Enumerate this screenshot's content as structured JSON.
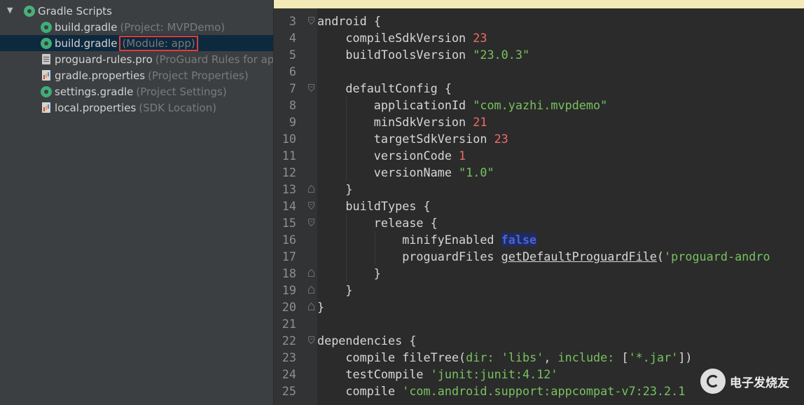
{
  "project_tree": {
    "root": {
      "label": "Gradle Scripts",
      "expanded": true
    },
    "items": [
      {
        "name": "build.gradle",
        "hint": "(Project: MVPDemo)",
        "icon": "gradle-icon",
        "selected": false,
        "highlighted": false
      },
      {
        "name": "build.gradle",
        "hint": "(Module: app)",
        "icon": "gradle-icon",
        "selected": true,
        "highlighted": true
      },
      {
        "name": "proguard-rules.pro",
        "hint": "(ProGuard Rules for app",
        "icon": "text-file-icon",
        "selected": false,
        "highlighted": false
      },
      {
        "name": "gradle.properties",
        "hint": "(Project Properties)",
        "icon": "properties-file-icon",
        "selected": false,
        "highlighted": false
      },
      {
        "name": "settings.gradle",
        "hint": "(Project Settings)",
        "icon": "gradle-icon",
        "selected": false,
        "highlighted": false
      },
      {
        "name": "local.properties",
        "hint": "(SDK Location)",
        "icon": "properties-file-icon",
        "selected": false,
        "highlighted": false
      }
    ]
  },
  "editor": {
    "lines": [
      {
        "num": "3",
        "indent": 0,
        "fold": "open",
        "tokens": [
          [
            "android {",
            "tx"
          ]
        ]
      },
      {
        "num": "4",
        "indent": 1,
        "fold": "",
        "tokens": [
          [
            "compileSdkVersion ",
            "tx"
          ],
          [
            "23",
            "num"
          ]
        ]
      },
      {
        "num": "5",
        "indent": 1,
        "fold": "",
        "tokens": [
          [
            "buildToolsVersion ",
            "tx"
          ],
          [
            "\"23.0.3\"",
            "str"
          ]
        ]
      },
      {
        "num": "6",
        "indent": 0,
        "fold": "",
        "tokens": []
      },
      {
        "num": "7",
        "indent": 1,
        "fold": "open",
        "tokens": [
          [
            "defaultConfig {",
            "tx"
          ]
        ]
      },
      {
        "num": "8",
        "indent": 2,
        "fold": "",
        "tokens": [
          [
            "applicationId ",
            "tx"
          ],
          [
            "\"com.yazhi.mvpdemo\"",
            "str"
          ]
        ]
      },
      {
        "num": "9",
        "indent": 2,
        "fold": "",
        "tokens": [
          [
            "minSdkVersion ",
            "tx"
          ],
          [
            "21",
            "num"
          ]
        ]
      },
      {
        "num": "10",
        "indent": 2,
        "fold": "",
        "tokens": [
          [
            "targetSdkVersion ",
            "tx"
          ],
          [
            "23",
            "num"
          ]
        ]
      },
      {
        "num": "11",
        "indent": 2,
        "fold": "",
        "tokens": [
          [
            "versionCode ",
            "tx"
          ],
          [
            "1",
            "num"
          ]
        ]
      },
      {
        "num": "12",
        "indent": 2,
        "fold": "",
        "tokens": [
          [
            "versionName ",
            "tx"
          ],
          [
            "\"1.0\"",
            "str"
          ]
        ]
      },
      {
        "num": "13",
        "indent": 1,
        "fold": "close",
        "tokens": [
          [
            "}",
            "tx"
          ]
        ]
      },
      {
        "num": "14",
        "indent": 1,
        "fold": "open",
        "tokens": [
          [
            "buildTypes {",
            "tx"
          ]
        ]
      },
      {
        "num": "15",
        "indent": 2,
        "fold": "open",
        "tokens": [
          [
            "release {",
            "tx"
          ]
        ]
      },
      {
        "num": "16",
        "indent": 3,
        "fold": "",
        "tokens": [
          [
            "minifyEnabled ",
            "tx"
          ],
          [
            "false",
            "kw"
          ]
        ]
      },
      {
        "num": "17",
        "indent": 3,
        "fold": "",
        "tokens": [
          [
            "proguardFiles ",
            "tx"
          ],
          [
            "getDefaultProguardFile",
            "fn"
          ],
          [
            "(",
            "tx"
          ],
          [
            "'proguard-andro",
            "str"
          ]
        ]
      },
      {
        "num": "18",
        "indent": 2,
        "fold": "close",
        "tokens": [
          [
            "}",
            "tx"
          ]
        ]
      },
      {
        "num": "19",
        "indent": 1,
        "fold": "close",
        "tokens": [
          [
            "}",
            "tx"
          ]
        ]
      },
      {
        "num": "20",
        "indent": 0,
        "fold": "close",
        "tokens": [
          [
            "}",
            "tx"
          ]
        ]
      },
      {
        "num": "21",
        "indent": 0,
        "fold": "",
        "tokens": []
      },
      {
        "num": "22",
        "indent": 0,
        "fold": "open",
        "tokens": [
          [
            "dependencies {",
            "tx"
          ]
        ]
      },
      {
        "num": "23",
        "indent": 1,
        "fold": "",
        "tokens": [
          [
            "compile fileTree(",
            "tx"
          ],
          [
            "dir: ",
            "str"
          ],
          [
            "'libs'",
            "str"
          ],
          [
            ", ",
            "tx"
          ],
          [
            "include: ",
            "str"
          ],
          [
            "[",
            "tx"
          ],
          [
            "'*.jar'",
            "str"
          ],
          [
            "])",
            "tx"
          ]
        ]
      },
      {
        "num": "24",
        "indent": 1,
        "fold": "",
        "tokens": [
          [
            "testCompile ",
            "tx"
          ],
          [
            "'junit:junit:4.12'",
            "str"
          ]
        ]
      },
      {
        "num": "25",
        "indent": 1,
        "fold": "",
        "tokens": [
          [
            "compile ",
            "tx"
          ],
          [
            "'com.android.support:appcompat-v7:23.2.1",
            "str"
          ]
        ]
      }
    ]
  },
  "watermark": {
    "text": "电子发烧友"
  },
  "colors": {
    "selection": "#0d293e",
    "highlight_border": "#e03b3b",
    "number": "#f06a6a",
    "string": "#78c25f",
    "keyword": "#4a63d6"
  }
}
